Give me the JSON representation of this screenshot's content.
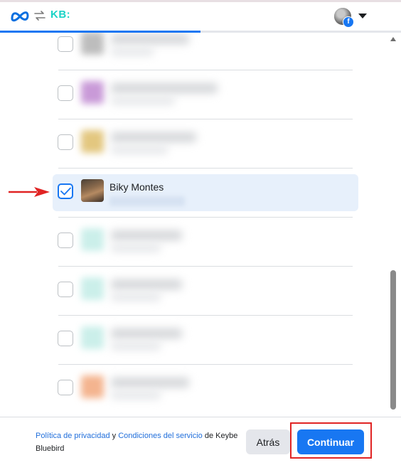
{
  "header": {
    "app_badge": "KB:",
    "progress_fraction": 0.5
  },
  "list": {
    "rows": [
      {
        "checked": false,
        "blurred": true,
        "thumb_color": "#bdbdbd"
      },
      {
        "checked": false,
        "blurred": true,
        "thumb_color": "#c99ad8"
      },
      {
        "checked": false,
        "blurred": true,
        "thumb_color": "#e3c77f"
      },
      {
        "checked": true,
        "blurred": false,
        "name": "Biky Montes"
      },
      {
        "checked": false,
        "blurred": true,
        "thumb_color": "#cbefea"
      },
      {
        "checked": false,
        "blurred": true,
        "thumb_color": "#cbefea"
      },
      {
        "checked": false,
        "blurred": true,
        "thumb_color": "#cbefea"
      },
      {
        "checked": false,
        "blurred": true,
        "thumb_color": "#f4b48f"
      }
    ]
  },
  "footer": {
    "privacy_link": "Política de privacidad",
    "conjunction": " y ",
    "terms_link": "Condiciones del servicio",
    "suffix": " de Keybe Bluebird",
    "back_label": "Atrás",
    "continue_label": "Continuar"
  },
  "colors": {
    "accent": "#1877f2",
    "selected_row": "#e7f0fb",
    "annotation": "#e02424"
  }
}
